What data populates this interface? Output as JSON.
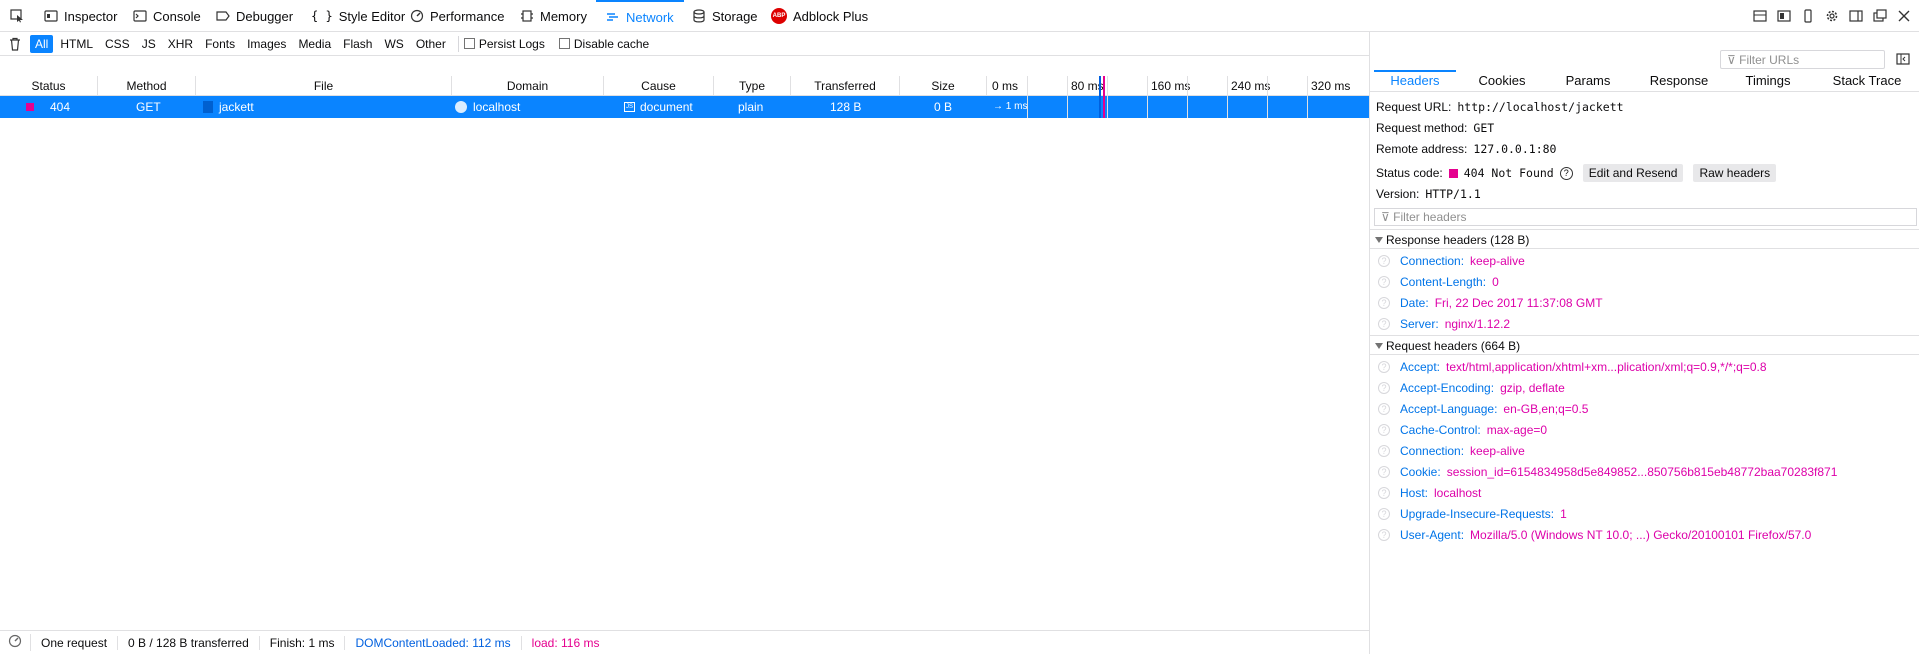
{
  "toolbar": {
    "tabs": [
      {
        "label": "Inspector",
        "icon": "inspector-icon"
      },
      {
        "label": "Console",
        "icon": "console-icon"
      },
      {
        "label": "Debugger",
        "icon": "debugger-icon"
      },
      {
        "label": "Style Editor",
        "icon": "braces-icon"
      },
      {
        "label": "Performance",
        "icon": "gauge-icon"
      },
      {
        "label": "Memory",
        "icon": "chip-icon"
      },
      {
        "label": "Network",
        "icon": "network-icon"
      },
      {
        "label": "Storage",
        "icon": "database-icon"
      },
      {
        "label": "Adblock Plus",
        "icon": "abp-icon"
      }
    ],
    "active_tab": "Network"
  },
  "filters": {
    "types": [
      "All",
      "HTML",
      "CSS",
      "JS",
      "XHR",
      "Fonts",
      "Images",
      "Media",
      "Flash",
      "WS",
      "Other"
    ],
    "active": "All",
    "persist_logs": "Persist Logs",
    "disable_cache": "Disable cache",
    "url_filter_placeholder": "Filter URLs"
  },
  "table": {
    "columns": [
      "Status",
      "Method",
      "File",
      "Domain",
      "Cause",
      "Type",
      "Transferred",
      "Size",
      "0 ms",
      "80 ms",
      "160 ms",
      "240 ms",
      "320 ms"
    ],
    "row": {
      "status": "404",
      "method": "GET",
      "file": "jackett",
      "domain": "localhost",
      "cause": "document",
      "type": "plain",
      "transferred": "128 B",
      "size": "0 B",
      "timing": "→ 1 ms",
      "status_color": "#e5008f"
    }
  },
  "panel": {
    "tabs": [
      "Headers",
      "Cookies",
      "Params",
      "Response",
      "Timings",
      "Stack Trace"
    ],
    "active_tab": "Headers",
    "request_url_label": "Request URL:",
    "request_url": "http://localhost/jackett",
    "request_method_label": "Request method:",
    "request_method": "GET",
    "remote_address_label": "Remote address:",
    "remote_address": "127.0.0.1:80",
    "status_code_label": "Status code:",
    "status_code": "404 Not Found",
    "edit_resend": "Edit and Resend",
    "raw_headers": "Raw headers",
    "version_label": "Version:",
    "version": "HTTP/1.1",
    "filter_headers_placeholder": "Filter headers",
    "response_headers_title": "Response headers (128 B)",
    "response_headers": [
      {
        "name": "Connection:",
        "value": "keep-alive"
      },
      {
        "name": "Content-Length:",
        "value": "0"
      },
      {
        "name": "Date:",
        "value": "Fri, 22 Dec 2017 11:37:08 GMT"
      },
      {
        "name": "Server:",
        "value": "nginx/1.12.2"
      }
    ],
    "request_headers_title": "Request headers (664 B)",
    "request_headers": [
      {
        "name": "Accept:",
        "value": "text/html,application/xhtml+xm...plication/xml;q=0.9,*/*;q=0.8"
      },
      {
        "name": "Accept-Encoding:",
        "value": "gzip, deflate"
      },
      {
        "name": "Accept-Language:",
        "value": "en-GB,en;q=0.5"
      },
      {
        "name": "Cache-Control:",
        "value": "max-age=0"
      },
      {
        "name": "Connection:",
        "value": "keep-alive"
      },
      {
        "name": "Cookie:",
        "value": "session_id=6154834958d5e849852...850756b815eb48772baa70283f871"
      },
      {
        "name": "Host:",
        "value": "localhost"
      },
      {
        "name": "Upgrade-Insecure-Requests:",
        "value": "1"
      },
      {
        "name": "User-Agent:",
        "value": "Mozilla/5.0 (Windows NT 10.0; ...) Gecko/20100101 Firefox/57.0"
      }
    ]
  },
  "statusbar": {
    "requests": "One request",
    "transferred": "0 B / 128 B transferred",
    "finish": "Finish: 1 ms",
    "dom_content_loaded": "DOMContentLoaded: 112 ms",
    "load": "load: 116 ms"
  }
}
